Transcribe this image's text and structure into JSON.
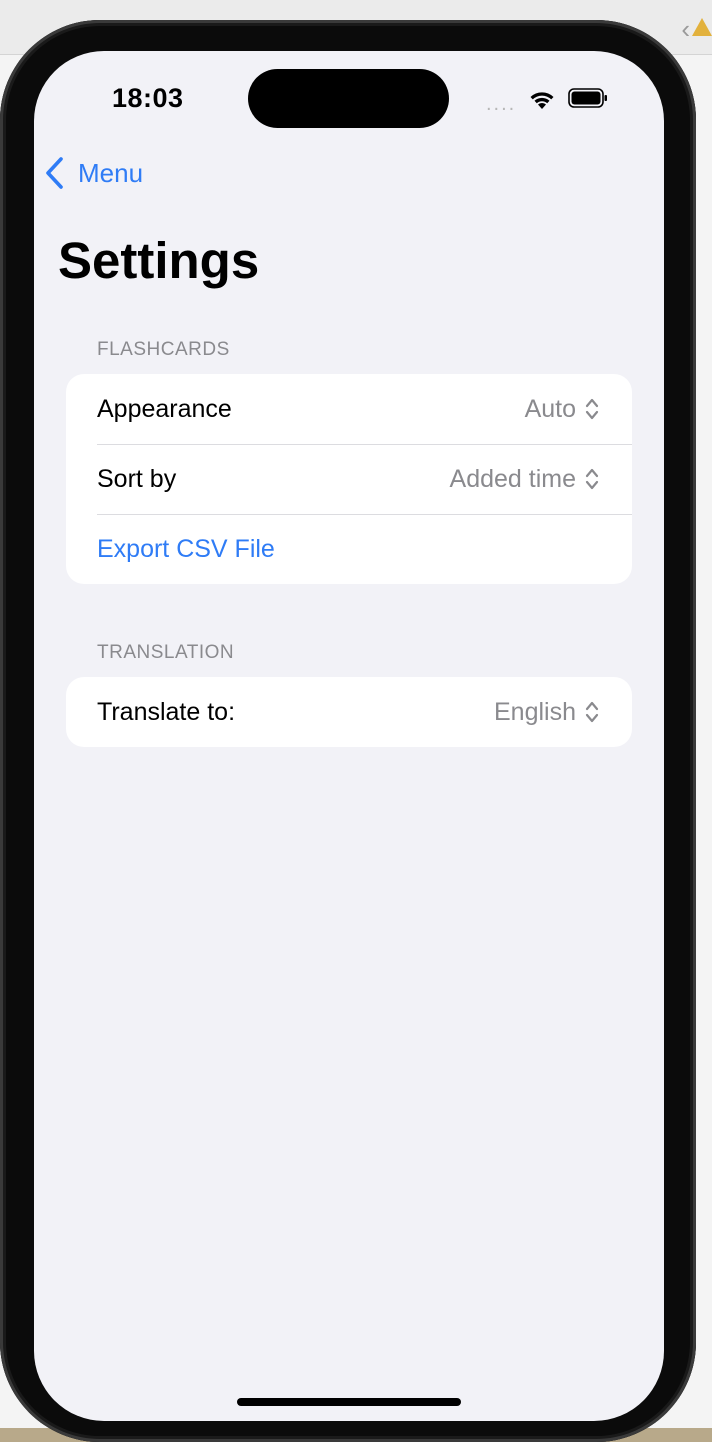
{
  "status_bar": {
    "time": "18:03",
    "signal_dots": "....",
    "wifi_icon": "wifi-icon",
    "battery_icon": "battery-icon"
  },
  "nav": {
    "back_label": "Menu",
    "back_icon": "chevron-left-icon"
  },
  "page": {
    "title": "Settings"
  },
  "sections": {
    "flashcards": {
      "header": "FLASHCARDS",
      "appearance": {
        "label": "Appearance",
        "value": "Auto"
      },
      "sort_by": {
        "label": "Sort by",
        "value": "Added time"
      },
      "export": {
        "label": "Export CSV File"
      }
    },
    "translation": {
      "header": "TRANSLATION",
      "translate_to": {
        "label": "Translate to:",
        "value": "English"
      }
    }
  },
  "colors": {
    "accent": "#2f7cf6",
    "background": "#f2f2f7",
    "secondary_text": "#8a8a8e"
  }
}
